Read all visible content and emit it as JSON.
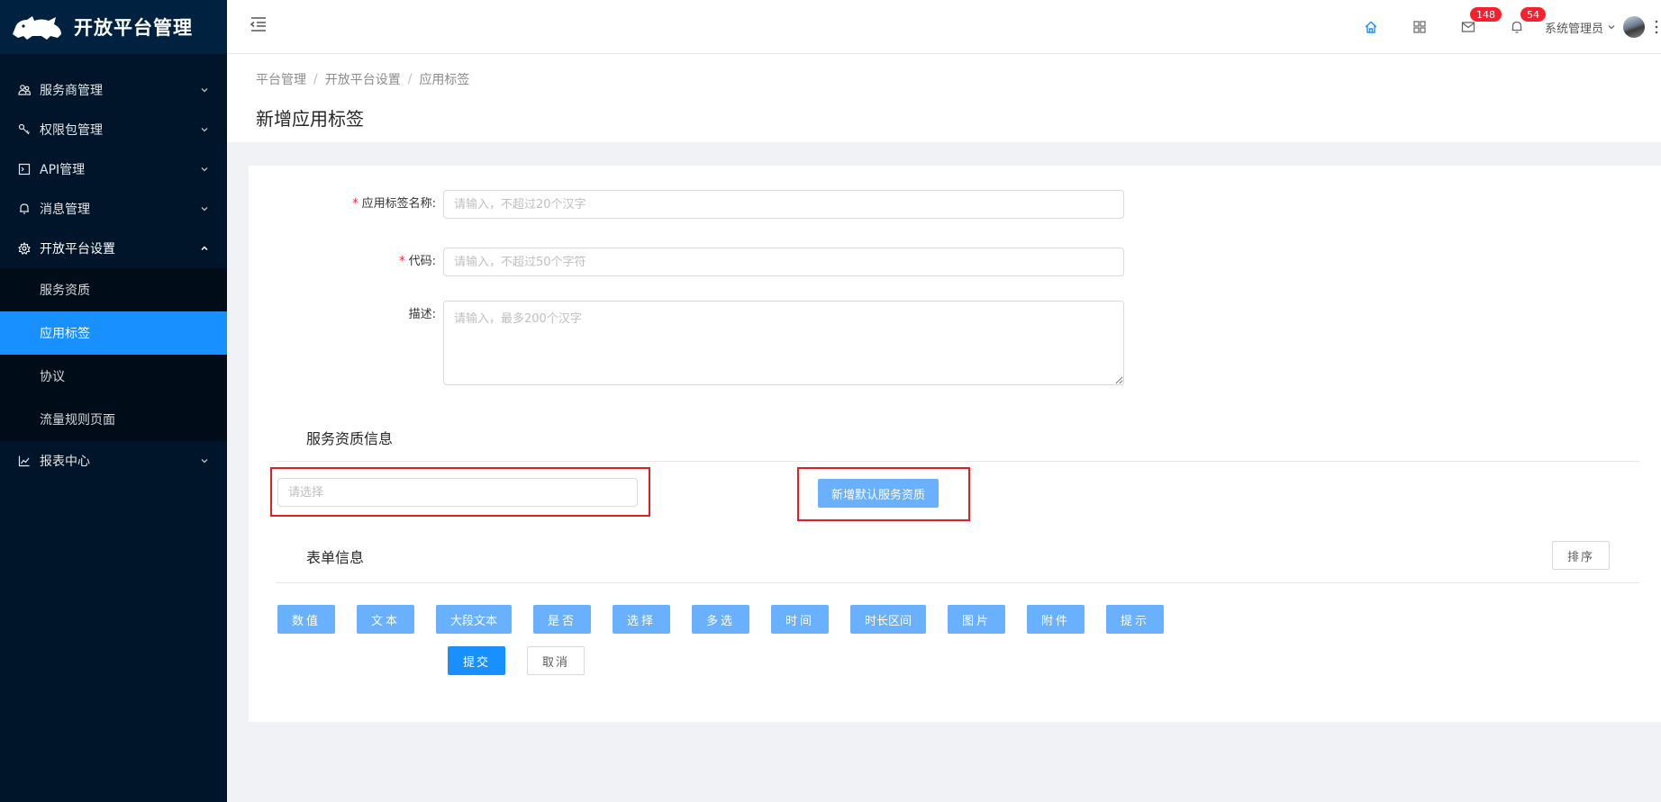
{
  "app": {
    "title": "开放平台管理"
  },
  "sidebar": {
    "items": [
      {
        "label": "服务商管理",
        "icon": "team-icon",
        "expanded": false
      },
      {
        "label": "权限包管理",
        "icon": "key-icon",
        "expanded": false
      },
      {
        "label": "API管理",
        "icon": "api-icon",
        "expanded": false
      },
      {
        "label": "消息管理",
        "icon": "bell-icon",
        "expanded": false
      },
      {
        "label": "开放平台设置",
        "icon": "gear-icon",
        "expanded": true
      },
      {
        "label": "报表中心",
        "icon": "chart-icon",
        "expanded": false
      }
    ],
    "sub_items": [
      {
        "label": "服务资质",
        "active": false
      },
      {
        "label": "应用标签",
        "active": true
      },
      {
        "label": "协议",
        "active": false
      },
      {
        "label": "流量规则页面",
        "active": false
      }
    ]
  },
  "header": {
    "mail_count": "148",
    "notify_count": "54",
    "user_name": "系统管理员"
  },
  "breadcrumb": [
    "平台管理",
    "开放平台设置",
    "应用标签"
  ],
  "page": {
    "title": "新增应用标签"
  },
  "form": {
    "name_label": "应用标签名称",
    "name_placeholder": "请输入，不超过20个汉字",
    "code_label": "代码",
    "code_placeholder": "请输入，不超过50个字符",
    "desc_label": "描述",
    "desc_placeholder": "请输入，最多200个汉字",
    "colon": ":"
  },
  "service_section": {
    "title": "服务资质信息",
    "select_placeholder": "请选择",
    "add_button": "新增默认服务资质"
  },
  "form_section": {
    "title": "表单信息",
    "sort_button": "排序",
    "field_types": [
      "数值",
      "文本",
      "大段文本",
      "是否",
      "选择",
      "多选",
      "时间",
      "时长区间",
      "图片",
      "附件",
      "提示"
    ]
  },
  "actions": {
    "submit": "提交",
    "cancel": "取消"
  },
  "colors": {
    "primary": "#1890ff",
    "primary_light": "#69b1ff",
    "sidebar_bg": "#001529",
    "badge": "#f5222d",
    "highlight_box": "#e02020"
  }
}
